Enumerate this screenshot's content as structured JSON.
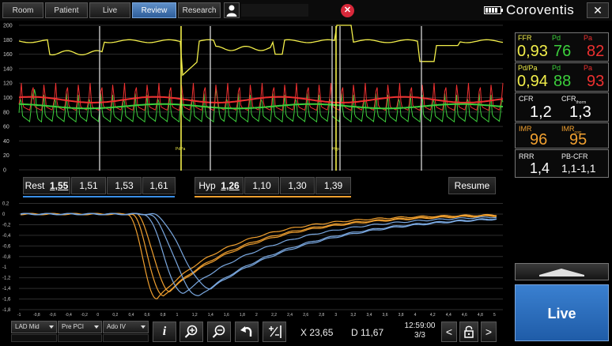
{
  "tabs": [
    {
      "label": "Room"
    },
    {
      "label": "Patient"
    },
    {
      "label": "Live"
    },
    {
      "label": "Review"
    },
    {
      "label": "Research"
    }
  ],
  "brand": "Coroventis",
  "top_chart": {
    "y_ticks": [
      "200",
      "180",
      "160",
      "140",
      "120",
      "100",
      "80",
      "60",
      "40",
      "20",
      "0"
    ],
    "markers": [
      "PdPa",
      "Hyp"
    ]
  },
  "rest": {
    "label": "Rest",
    "values": [
      "1,55",
      "1,51",
      "1,53",
      "1,61"
    ]
  },
  "hyp": {
    "label": "Hyp",
    "values": [
      "1,26",
      "1,10",
      "1,30",
      "1,39"
    ]
  },
  "resume_label": "Resume",
  "bottom_chart": {
    "y_ticks": [
      "0,2",
      "0",
      "-0,2",
      "-0,4",
      "-0,6",
      "-0,8",
      "-1",
      "-1,2",
      "-1,4",
      "-1,6",
      "-1,8"
    ],
    "x_ticks": [
      "-1",
      "-0,8",
      "-0,6",
      "-0,4",
      "-0,2",
      "0",
      "0,2",
      "0,4",
      "0,6",
      "0,8",
      "1",
      "1,2",
      "1,4",
      "1,6",
      "1,8",
      "2",
      "2,2",
      "2,4",
      "2,6",
      "2,8",
      "3",
      "3,2",
      "3,4",
      "3,6",
      "3,8",
      "4",
      "4,2",
      "4,4",
      "4,6",
      "4,8",
      "5"
    ]
  },
  "panels": {
    "ffr": {
      "label_a": "FFR",
      "label_b": "Pd",
      "label_c": "Pa",
      "val_a": "0,93",
      "val_b": "76",
      "val_c": "82"
    },
    "pdpa": {
      "label_a": "Pd/Pa",
      "label_b": "Pd",
      "label_c": "Pa",
      "val_a": "0,94",
      "val_b": "88",
      "val_c": "93"
    },
    "cfr": {
      "label_a": "CFR",
      "label_b": "CFR",
      "label_b_sub": "thorm",
      "val_a": "1,2",
      "val_b": "1,3"
    },
    "imr": {
      "label_a": "IMR",
      "label_b": "IMR",
      "label_b_sub": "corr",
      "val_a": "96",
      "val_b": "95"
    },
    "rrr": {
      "label_a": "RRR",
      "label_b": "PB-CFR",
      "val_a": "1,4",
      "val_b": "1,1-1,1"
    }
  },
  "live_label": "Live",
  "dropdowns": [
    {
      "label": "LAD Mid"
    },
    {
      "label": "Pre PCI"
    },
    {
      "label": "Ado IV"
    }
  ],
  "readouts": {
    "x": "X 23,65",
    "d": "D 11,67",
    "time": "12:59:00",
    "page": "3/3"
  },
  "colors": {
    "yellow": "#f2ee4a",
    "green": "#3ccf3c",
    "red": "#ee3030",
    "orange": "#f0a030",
    "blue": "#7aa8e0",
    "accent": "#2f6eb8"
  }
}
